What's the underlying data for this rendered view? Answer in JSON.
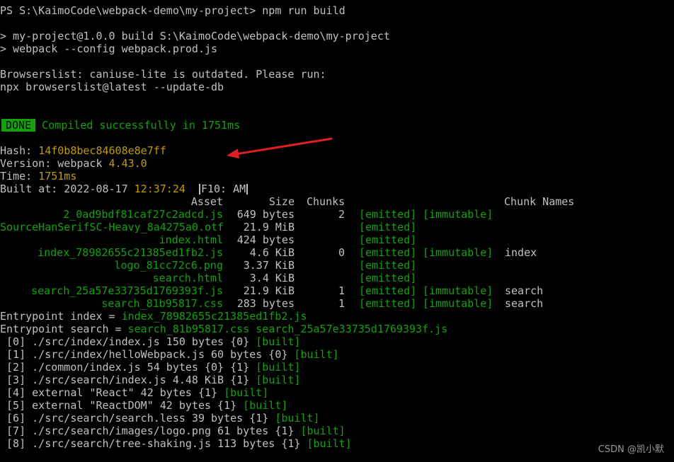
{
  "prompt": "PS S:\\KaimoCode\\webpack-demo\\my-project> ",
  "command": "npm run build",
  "script_lines": [
    "> my-project@1.0.0 build S:\\KaimoCode\\webpack-demo\\my-project",
    "> webpack --config webpack.prod.js"
  ],
  "browserslist": [
    "Browserslist: caniuse-lite is outdated. Please run:",
    "npx browserslist@latest --update-db"
  ],
  "done_badge": "DONE",
  "done_message": "Compiled successfully in 1751ms",
  "hash_label": "Hash: ",
  "hash_value": "14f0b8bec84608e8e7ff",
  "version_label": "Version: webpack ",
  "version_value": "4.43.0",
  "time_label": "Time: ",
  "time_value": "1751ms",
  "built_label": "Built at: 2022-08-17 ",
  "built_time": "12:37:24",
  "ime_text": "F10: AM",
  "headers": {
    "asset": "Asset",
    "size": "Size",
    "chunks": "Chunks",
    "chunk_names": "Chunk Names"
  },
  "assets": [
    {
      "name": "2_0ad9bdf81caf27c2adcd.js",
      "size": "649 bytes",
      "chunks": "2",
      "emitted": "[emitted]",
      "immutable": "[immutable]",
      "chunk_names": ""
    },
    {
      "name": "SourceHanSerifSC-Heavy_8a4275a0.otf",
      "size": "21.9 MiB",
      "chunks": "",
      "emitted": "[emitted]",
      "immutable": "",
      "chunk_names": ""
    },
    {
      "name": "index.html",
      "size": "424 bytes",
      "chunks": "",
      "emitted": "[emitted]",
      "immutable": "",
      "chunk_names": ""
    },
    {
      "name": "index_78982655c21385ed1fb2.js",
      "size": "4.6 KiB",
      "chunks": "0",
      "emitted": "[emitted]",
      "immutable": "[immutable]",
      "chunk_names": "index"
    },
    {
      "name": "logo_81cc72c6.png",
      "size": "3.37 KiB",
      "chunks": "",
      "emitted": "[emitted]",
      "immutable": "",
      "chunk_names": ""
    },
    {
      "name": "search.html",
      "size": "3.4 KiB",
      "chunks": "",
      "emitted": "[emitted]",
      "immutable": "",
      "chunk_names": ""
    },
    {
      "name": "search_25a57e33735d1769393f.js",
      "size": "21.9 KiB",
      "chunks": "1",
      "emitted": "[emitted]",
      "immutable": "[immutable]",
      "chunk_names": "search"
    },
    {
      "name": "search_81b95817.css",
      "size": "283 bytes",
      "chunks": "1",
      "emitted": "[emitted]",
      "immutable": "[immutable]",
      "chunk_names": "search"
    }
  ],
  "entrypoints": [
    {
      "label": "Entrypoint index = ",
      "files": "index_78982655c21385ed1fb2.js"
    },
    {
      "label": "Entrypoint search = ",
      "files": "search_81b95817.css search_25a57e33735d1769393f.js"
    }
  ],
  "modules": [
    {
      "text": " [0] ./src/index/index.js 150 bytes {0} ",
      "built": "[built]"
    },
    {
      "text": " [1] ./src/index/helloWebpack.js 60 bytes {0} ",
      "built": "[built]"
    },
    {
      "text": " [2] ./common/index.js 54 bytes {0} {1} ",
      "built": "[built]"
    },
    {
      "text": " [3] ./src/search/index.js 4.48 KiB {1} ",
      "built": "[built]"
    },
    {
      "text": " [4] external \"React\" 42 bytes {1} ",
      "built": "[built]"
    },
    {
      "text": " [5] external \"ReactDOM\" 42 bytes {1} ",
      "built": "[built]"
    },
    {
      "text": " [6] ./src/search/search.less 39 bytes {1} ",
      "built": "[built]"
    },
    {
      "text": " [7] ./src/search/images/logo.png 61 bytes {1} ",
      "built": "[built]"
    },
    {
      "text": " [8] ./src/search/tree-shaking.js 113 bytes {1} ",
      "built": "[built]"
    }
  ],
  "watermark": "CSDN @凯小默",
  "colors": {
    "green": "#13a10e",
    "yellow": "#c19c00",
    "arrow": "#e02020"
  }
}
